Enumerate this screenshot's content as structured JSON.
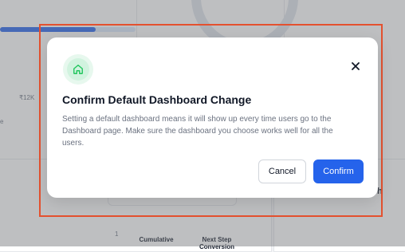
{
  "background": {
    "tick_label": "₹12K",
    "side_letter": "e",
    "row_number": "1",
    "column_cumulative": "Cumulative",
    "column_next_step": "Next Step Conversion",
    "right_letter": "h"
  },
  "modal": {
    "icon": "home-icon",
    "title": "Confirm Default Dashboard Change",
    "description": "Setting a default dashboard means it will show up every time users go to the Dashboard page. Make sure the dashboard you choose works well for all the users.",
    "close_icon": "close-icon",
    "cancel_label": "Cancel",
    "confirm_label": "Confirm"
  },
  "colors": {
    "accent": "#2563eb",
    "icon_green": "#22c55e",
    "highlight": "#e4512f"
  }
}
